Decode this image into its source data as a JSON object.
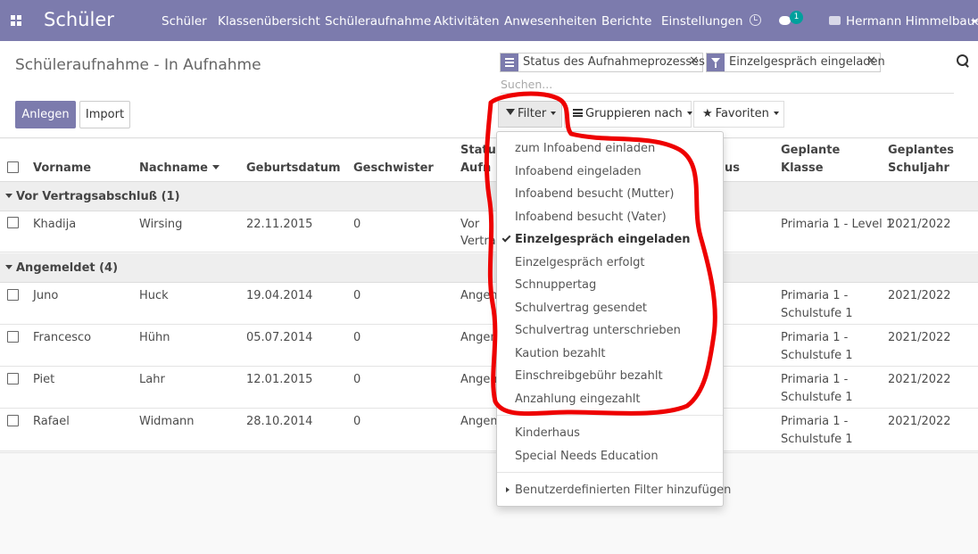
{
  "navbar": {
    "brand": "Schüler",
    "menu": [
      "Schüler",
      "Klassenübersicht",
      "Schüleraufnahme",
      "Aktivitäten",
      "Anwesenheiten",
      "Berichte",
      "Einstellungen"
    ],
    "messages_badge": "1",
    "user": "Hermann Himmelbauer",
    "colors": {
      "navbar_bg": "#7c7bad",
      "badge_bg": "#00a09d"
    }
  },
  "control_panel": {
    "title": "Schüleraufnahme - In Aufnahme",
    "create_label": "Anlegen",
    "import_label": "Import",
    "facets": [
      {
        "icon": "group-by-icon",
        "label": "Status des Aufnahmeprozesses"
      },
      {
        "icon": "filter-icon",
        "label": "Einzelgespräch eingeladen"
      }
    ],
    "search_placeholder": "Suchen...",
    "filter_label": "Filter",
    "group_by_label": "Gruppieren nach",
    "favorites_label": "Favoriten"
  },
  "table": {
    "columns": [
      "Vorname",
      "Nachname",
      "Geburtsdatum",
      "Geschwister",
      "Status",
      "Aufn",
      "us",
      "Geplante",
      "Klasse",
      "Geplantes",
      "Schuljahr"
    ],
    "groups": [
      {
        "label": "Vor Vertragsabschluß (1)"
      },
      {
        "label": "Angemeldet (4)"
      }
    ],
    "rows": [
      {
        "vorname": "Khadija",
        "nachname": "Wirsing",
        "geburtsdatum": "22.11.2015",
        "geschwister": "0",
        "status_1": "Vor",
        "status_2": "Vertra",
        "klasse": "Primaria 1 - Level 1",
        "schuljahr": "2021/2022"
      },
      {
        "vorname": "Juno",
        "nachname": "Huck",
        "geburtsdatum": "19.04.2014",
        "geschwister": "0",
        "status_1": "Angem",
        "klasse_1": "Primaria 1 -",
        "klasse_2": "Schulstufe 1",
        "schuljahr": "2021/2022"
      },
      {
        "vorname": "Francesco",
        "nachname": "Hühn",
        "geburtsdatum": "05.07.2014",
        "geschwister": "0",
        "status_1": "Angem",
        "klasse_1": "Primaria 1 -",
        "klasse_2": "Schulstufe 1",
        "schuljahr": "2021/2022"
      },
      {
        "vorname": "Piet",
        "nachname": "Lahr",
        "geburtsdatum": "12.01.2015",
        "geschwister": "0",
        "status_1": "Angem",
        "klasse_1": "Primaria 1 -",
        "klasse_2": "Schulstufe 1",
        "schuljahr": "2021/2022"
      },
      {
        "vorname": "Rafael",
        "nachname": "Widmann",
        "geburtsdatum": "28.10.2014",
        "geschwister": "0",
        "status_1": "Angem",
        "klasse_1": "Primaria 1 -",
        "klasse_2": "Schulstufe 1",
        "schuljahr": "2021/2022"
      }
    ]
  },
  "filter_dropdown": {
    "status_filters": [
      {
        "label": "zum Infoabend einladen",
        "selected": false
      },
      {
        "label": "Infoabend eingeladen",
        "selected": false
      },
      {
        "label": "Infoabend besucht (Mutter)",
        "selected": false
      },
      {
        "label": "Infoabend besucht (Vater)",
        "selected": false
      },
      {
        "label": "Einzelgespräch eingeladen",
        "selected": true
      },
      {
        "label": "Einzelgespräch erfolgt",
        "selected": false
      },
      {
        "label": "Schnuppertag",
        "selected": false
      },
      {
        "label": "Schulvertrag gesendet",
        "selected": false
      },
      {
        "label": "Schulvertrag unterschrieben",
        "selected": false
      },
      {
        "label": "Kaution bezahlt",
        "selected": false
      },
      {
        "label": "Einschreibgebühr bezahlt",
        "selected": false
      },
      {
        "label": "Anzahlung eingezahlt",
        "selected": false
      }
    ],
    "other_filters": [
      "Kinderhaus",
      "Special Needs Education"
    ],
    "custom_filter_label": "Benutzerdefinierten Filter hinzufügen"
  },
  "annotation": {
    "color": "#ee0000"
  }
}
